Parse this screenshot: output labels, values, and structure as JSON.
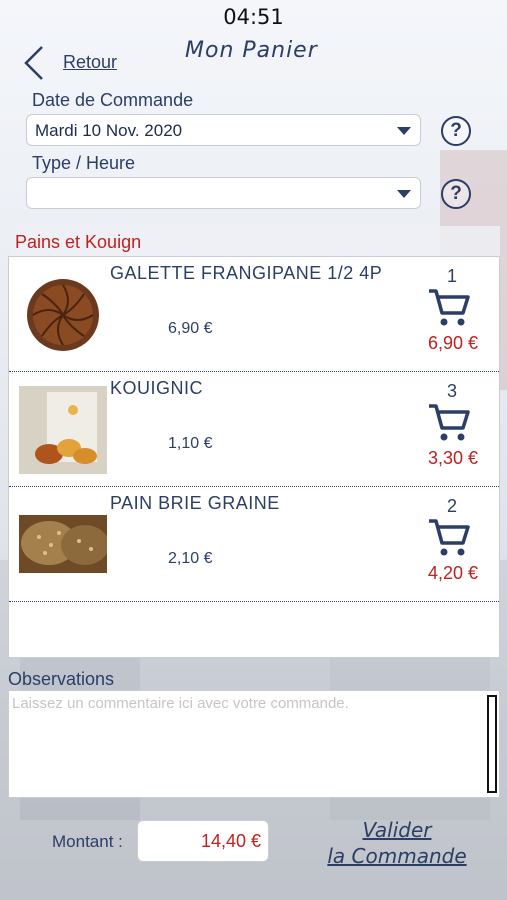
{
  "status_bar": {
    "time": "04:51"
  },
  "header": {
    "back_label": "Retour",
    "title": "Mon Panier"
  },
  "order_form": {
    "date_label": "Date de Commande",
    "date_value": "Mardi 10 Nov. 2020",
    "type_label": "Type / Heure",
    "type_value": "",
    "help_glyph": "?"
  },
  "section": {
    "title": "Pains et Kouign"
  },
  "cart_items": [
    {
      "name": "GALETTE FRANGIPANE 1/2 4P",
      "unit_price": "6,90 €",
      "qty": "1",
      "line_total": "6,90 €",
      "image": "galette-image"
    },
    {
      "name": "KOUIGNIC",
      "unit_price": "1,10 €",
      "qty": "3",
      "line_total": "3,30 €",
      "image": "kouignic-image"
    },
    {
      "name": "PAIN BRIE GRAINE",
      "unit_price": "2,10 €",
      "qty": "2",
      "line_total": "4,20 €",
      "image": "pain-brie-image"
    }
  ],
  "observations": {
    "label": "Observations",
    "placeholder": "Laissez un commentaire ici avec votre commande."
  },
  "footer": {
    "total_label": "Montant :",
    "total_value": "14,40 €",
    "validate_line1": "Valider",
    "validate_line2": "la Commande"
  },
  "colors": {
    "accent": "#2c3e66",
    "price_red": "#c0201e"
  },
  "icons": [
    "chevron-left-icon",
    "caret-down-icon",
    "help-icon",
    "cart-icon"
  ]
}
